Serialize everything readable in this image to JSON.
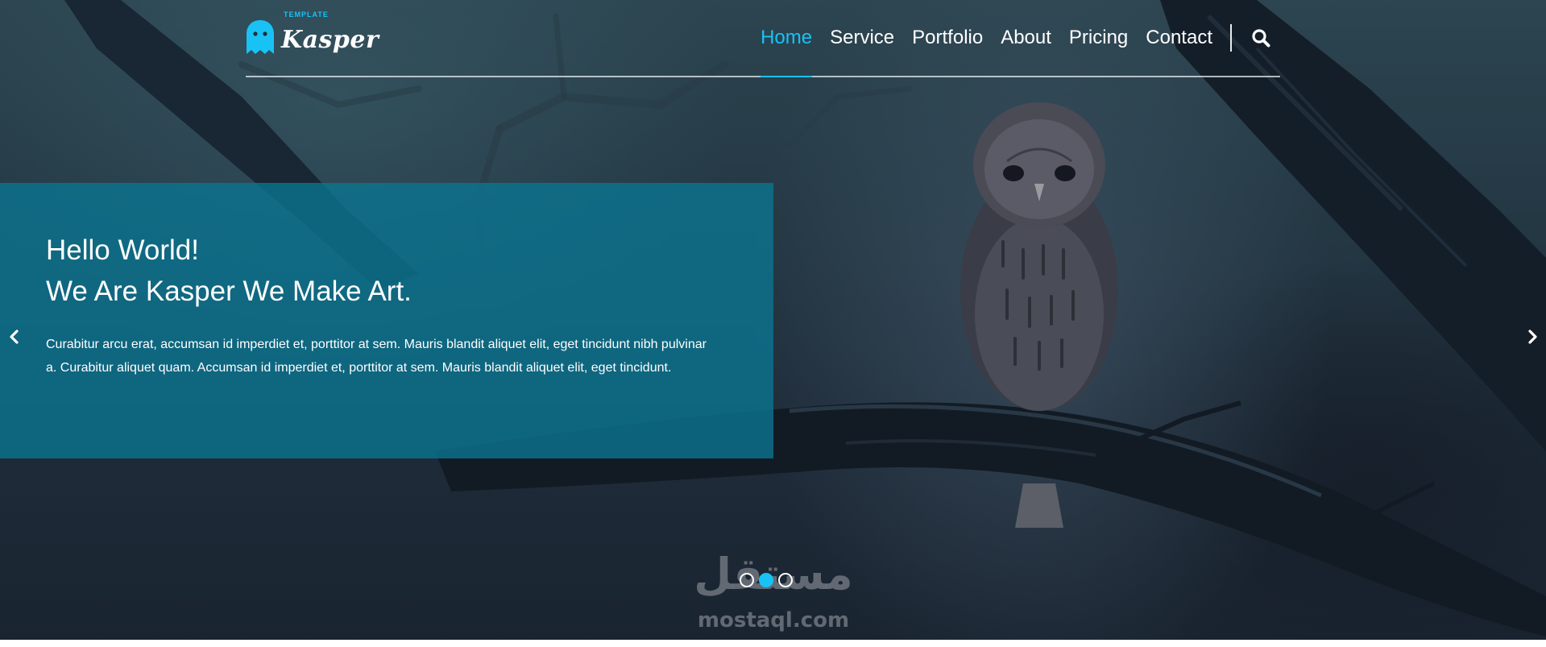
{
  "brand": {
    "name": "Kasper",
    "tag": "TEMPLATE",
    "icon": "ghost-icon",
    "accent_color": "#19c2f5"
  },
  "nav": {
    "items": [
      {
        "label": "Home",
        "active": true
      },
      {
        "label": "Service",
        "active": false
      },
      {
        "label": "Portfolio",
        "active": false
      },
      {
        "label": "About",
        "active": false
      },
      {
        "label": "Pricing",
        "active": false
      },
      {
        "label": "Contact",
        "active": false
      }
    ],
    "search_icon": "search-icon"
  },
  "hero": {
    "title_line1": "Hello World!",
    "title_line2": "We Are Kasper We Make Art.",
    "description": "Curabitur arcu erat, accumsan id imperdiet et, porttitor at sem. Mauris blandit aliquet elit, eget tincidunt nibh pulvinar a. Curabitur aliquet quam. Accumsan id imperdiet et, porttitor at sem. Mauris blandit aliquet elit, eget tincidunt.",
    "panel_color": "#0a7692"
  },
  "slider": {
    "prev_icon": "chevron-left-icon",
    "next_icon": "chevron-right-icon",
    "dots": [
      {
        "active": false
      },
      {
        "active": true
      },
      {
        "active": false
      }
    ]
  },
  "watermark": {
    "arabic": "مستقل",
    "latin": "mostaql.com"
  }
}
